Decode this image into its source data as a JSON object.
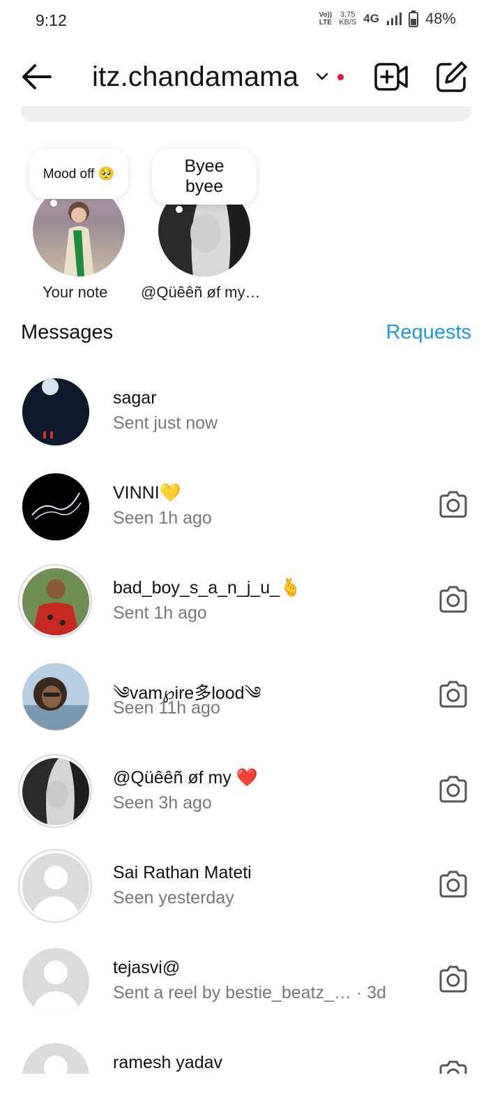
{
  "status_bar": {
    "time": "9:12",
    "volte_top": "Vo))",
    "volte_bottom": "LTE",
    "speed_value": "3.75",
    "speed_unit": "KB/S",
    "network": "4G",
    "battery": "48%"
  },
  "header": {
    "account_name": "itz.chandamama",
    "has_unread_dot": true,
    "accent_dot_color": "#e0133f"
  },
  "notes": [
    {
      "bubble_text": "Mood off 🥺",
      "label": "Your note"
    },
    {
      "bubble_text": "Byee byee",
      "label": "@Qüêêñ øf my…"
    }
  ],
  "messages_section": {
    "title": "Messages",
    "requests_label": "Requests",
    "requests_color": "#1a95e8"
  },
  "threads": [
    {
      "name": "sagar",
      "status": "Sent just now",
      "camera": false
    },
    {
      "name": "VINNI💛",
      "status": "Seen 1h ago",
      "camera": true
    },
    {
      "name": "bad_boy_s_a_n_j_u_🫰",
      "status": "Sent 1h ago",
      "camera": true
    },
    {
      "name": "༄vam℘ire多lood༄",
      "status": "Seen 11h ago",
      "camera": true
    },
    {
      "name": "@Qüêêñ øf my ❤️",
      "status": "Seen 3h ago",
      "camera": true
    },
    {
      "name": "Sai Rathan Mateti",
      "status": "Seen yesterday",
      "camera": true
    },
    {
      "name": "tejasvi@",
      "status": "Sent a reel by bestie_beatz_… · 3d",
      "camera": true
    },
    {
      "name": "ramesh yadav",
      "status": "",
      "camera": true
    }
  ]
}
